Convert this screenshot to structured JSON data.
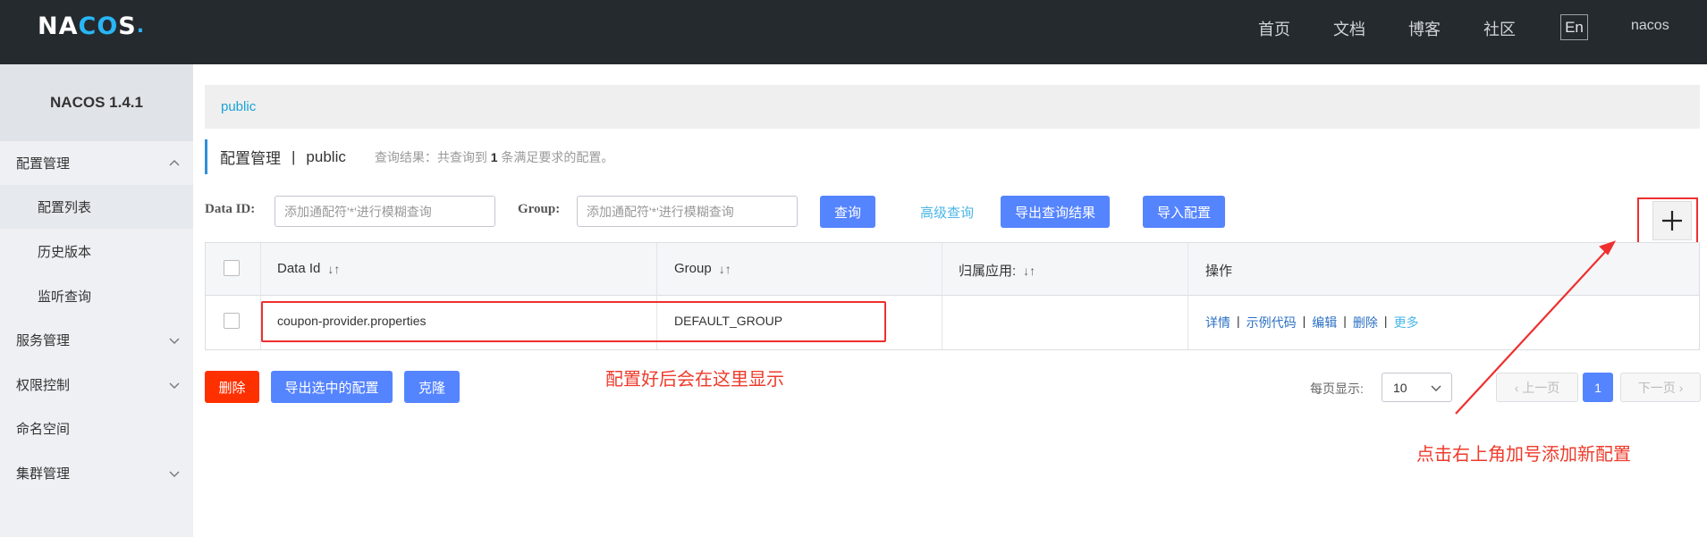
{
  "header": {
    "logo_prefix": "NA",
    "logo_oo": "CO",
    "logo_suffix": "S",
    "logo_dot": ".",
    "nav": [
      "首页",
      "文档",
      "博客",
      "社区"
    ],
    "lang": "En",
    "user": "nacos"
  },
  "sidebar": {
    "version": "NACOS 1.4.1",
    "items": [
      {
        "label": "配置管理",
        "expanded": true
      },
      {
        "label": "配置列表"
      },
      {
        "label": "历史版本"
      },
      {
        "label": "监听查询"
      },
      {
        "label": "服务管理"
      },
      {
        "label": "权限控制"
      },
      {
        "label": "命名空间"
      },
      {
        "label": "集群管理"
      }
    ]
  },
  "breadcrumb": {
    "namespace": "public"
  },
  "title": {
    "text": "配置管理",
    "sep": "|",
    "namespace": "public",
    "result_prefix": "查询结果：共查询到",
    "result_count": "1",
    "result_suffix": "条满足要求的配置。"
  },
  "search": {
    "dataid_label": "Data ID:",
    "dataid_placeholder": "添加通配符'*'进行模糊查询",
    "group_label": "Group:",
    "group_placeholder": "添加通配符'*'进行模糊查询",
    "query_button": "查询",
    "advanced_link": "高级查询",
    "export_button": "导出查询结果",
    "import_button": "导入配置"
  },
  "table": {
    "headers": [
      "Data Id",
      "Group",
      "归属应用:",
      "操作"
    ],
    "rows": [
      {
        "data_id": "coupon-provider.properties",
        "group": "DEFAULT_GROUP",
        "app": ""
      }
    ],
    "ops": [
      "详情",
      "示例代码",
      "编辑",
      "删除",
      "更多"
    ],
    "op_separator": "|"
  },
  "actions": {
    "delete": "删除",
    "export_selected": "导出选中的配置",
    "clone": "克隆"
  },
  "annotations": {
    "row_note": "配置好后会在这里显示",
    "plus_note": "点击右上角加号添加新配置"
  },
  "pagination": {
    "per_page_label": "每页显示:",
    "per_page": "10",
    "prev": "上一页",
    "current": "1",
    "next": "下一页"
  },
  "colors": {
    "topbar": "#252a2f",
    "primary": "#5584ff",
    "danger": "#ff3000",
    "annotation": "#ee3b2b",
    "link": "#2b70c4"
  }
}
